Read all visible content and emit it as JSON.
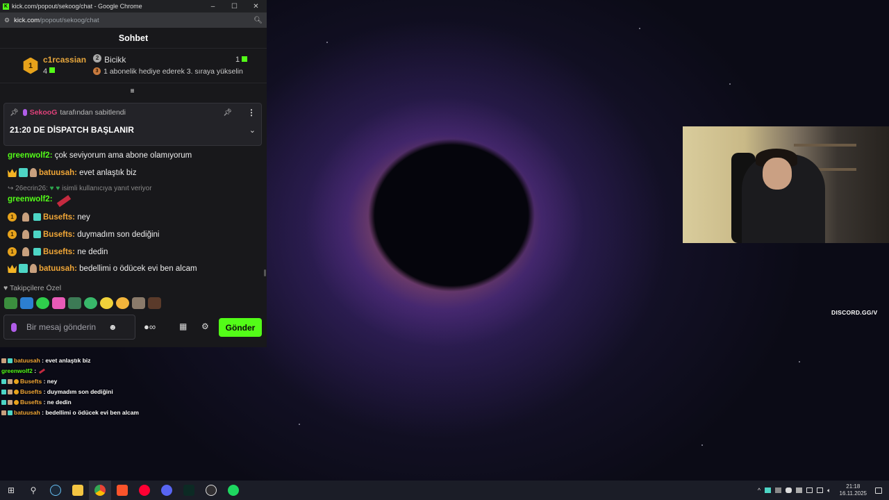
{
  "window": {
    "title": "kick.com/popout/sekoog/chat - Google Chrome",
    "controls": {
      "minimize": "–",
      "maximize": "☐",
      "close": "✕"
    }
  },
  "urlbar": {
    "host": "kick.com",
    "path": "/popout/sekoog/chat"
  },
  "chat": {
    "header": "Sohbet",
    "leaderboard": {
      "first_rank": "1",
      "first_name": "c1rcassian",
      "first_count": "4",
      "second_rank": "2",
      "second_name": "Bicikk",
      "second_count": "1",
      "third_rank": "3",
      "third_text": "1 abonelik hediye ederek 3. sıraya yükselin"
    },
    "pinned": {
      "user": "SekooG",
      "by_text": "tarafından sabitlendi",
      "message": "21:20 DE DİSPATCH BAŞLANIR"
    },
    "messages": [
      {
        "user": "greenwolf2:",
        "text": "çok seviyorum ama abone olamıyorum"
      },
      {
        "user": "batuusah:",
        "text": "evet anlaştık biz"
      },
      {
        "reply_user": "26ecrin26:",
        "reply_text": "isimli kullanıcıya yanıt veriyor"
      },
      {
        "user": "greenwolf2:",
        "text": ""
      },
      {
        "badge": "1",
        "user": "Busefts:",
        "text": "ney"
      },
      {
        "badge": "1",
        "user": "Busefts:",
        "text": "duymadım son dediğini"
      },
      {
        "badge": "1",
        "user": "Busefts:",
        "text": "ne dedin"
      },
      {
        "user": "batuusah:",
        "text": "bedellimi o ödücek evi ben alcam"
      }
    ],
    "followers_only": "Takipçilere Özel",
    "input_placeholder": "Bir mesaj gönderin",
    "send_label": "Gönder"
  },
  "overlay_chat": [
    {
      "user": "batuusah",
      "text": ": evet anlaştık biz"
    },
    {
      "user": "greenwolf2",
      "text": ":"
    },
    {
      "user": "Busefts",
      "text": ": ney"
    },
    {
      "user": "Busefts",
      "text": ": duymadım son dediğini"
    },
    {
      "user": "Busefts",
      "text": ": ne dedin"
    },
    {
      "user": "batuusah",
      "text": ": bedellimi o ödücek evi ben alcam"
    }
  ],
  "stream": {
    "discord_text": "DISCORD.GG/V"
  },
  "taskbar": {
    "time": "21:18",
    "date": "16.11.2025",
    "tray_chevron": "^"
  },
  "colors": {
    "accent": "#53fc18",
    "username_orange": "#f0a637",
    "pinned_user": "#e0417a"
  }
}
